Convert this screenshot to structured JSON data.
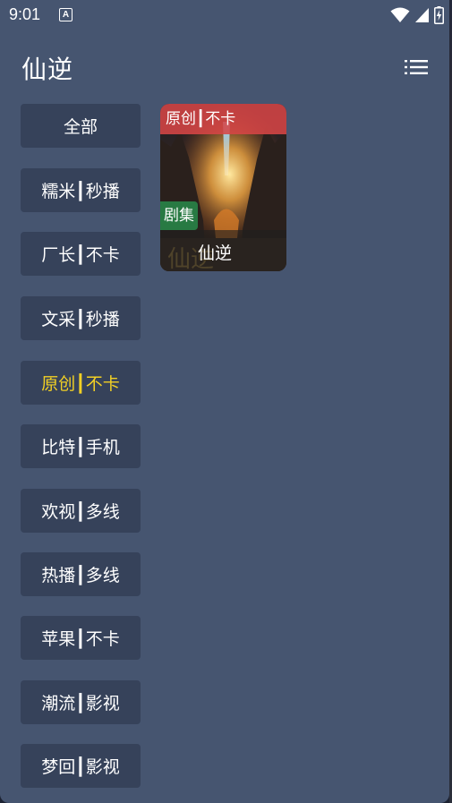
{
  "status_bar": {
    "time": "9:01",
    "notification_glyph": "A"
  },
  "header": {
    "title": "仙逆"
  },
  "categories": [
    {
      "label": "全部",
      "active": false
    },
    {
      "label": "糯米┃秒播",
      "active": false
    },
    {
      "label": "厂长┃不卡",
      "active": false
    },
    {
      "label": "文采┃秒播",
      "active": false
    },
    {
      "label": "原创┃不卡",
      "active": true
    },
    {
      "label": "比特┃手机",
      "active": false
    },
    {
      "label": "欢视┃多线",
      "active": false
    },
    {
      "label": "热播┃多线",
      "active": false
    },
    {
      "label": "苹果┃不卡",
      "active": false
    },
    {
      "label": "潮流┃影视",
      "active": false
    },
    {
      "label": "梦回┃影视",
      "active": false
    }
  ],
  "results": [
    {
      "title": "仙逆",
      "source_tag": "原创┃不卡",
      "type_tag": "剧集"
    }
  ],
  "colors": {
    "panel_bg": "#465570",
    "item_bg": "#36425a",
    "active_text": "#f2d024",
    "source_tag_bg": "#d64646",
    "type_tag_bg": "#288246"
  }
}
